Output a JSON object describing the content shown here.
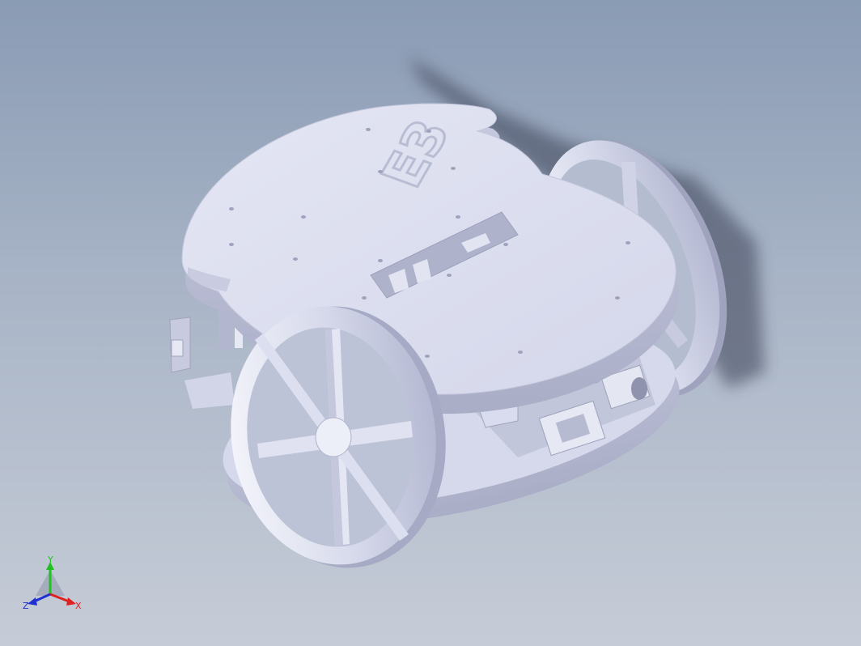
{
  "viewport": {
    "background_top": "#8a9bb4",
    "background_bottom": "#c6ccd7",
    "model_color": "#dde0f0"
  },
  "model": {
    "plate_marking": "E3"
  },
  "triad": {
    "x_label": "X",
    "y_label": "Y",
    "z_label": "Z",
    "x_color": "#e02020",
    "y_color": "#20c020",
    "z_color": "#2030d0"
  }
}
